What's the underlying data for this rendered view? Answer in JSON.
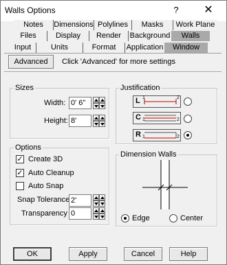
{
  "window": {
    "title": "Walls Options",
    "help_glyph": "?",
    "close_glyph": "✕"
  },
  "tabs": {
    "row1": [
      "Notes",
      "Dimensions",
      "Polylines",
      "Masks",
      "Work Plane"
    ],
    "row2": [
      "Files",
      "Display",
      "Render",
      "Background",
      "Walls"
    ],
    "row3": [
      "Input",
      "Units",
      "Format",
      "Application",
      "Window"
    ],
    "active": "Walls"
  },
  "advanced": {
    "button_label": "Advanced",
    "hint": "Click 'Advanced' for more settings"
  },
  "sizes": {
    "group_label": "Sizes",
    "width_label": "Width:",
    "width_value": "0' 6\"",
    "height_label": "Height:",
    "height_value": "8'"
  },
  "justification": {
    "group_label": "Justification",
    "options": [
      {
        "letter": "L",
        "sub_start": "1",
        "sub_end": "2",
        "selected": false
      },
      {
        "letter": "C",
        "sub_start": "1",
        "sub_end": "2",
        "selected": false
      },
      {
        "letter": "R",
        "sub_start": "1",
        "sub_end": "2",
        "selected": true
      }
    ]
  },
  "options": {
    "group_label": "Options",
    "create_3d": {
      "label": "Create 3D",
      "checked": true
    },
    "auto_cleanup": {
      "label": "Auto Cleanup",
      "checked": true
    },
    "auto_snap": {
      "label": "Auto Snap",
      "checked": false
    },
    "snap_tolerance_label": "Snap Tolerance",
    "snap_tolerance_value": "2'",
    "transparency_label": "Transparency",
    "transparency_value": "0"
  },
  "dimension_walls": {
    "group_label": "Dimension Walls",
    "edge_label": "Edge",
    "center_label": "Center",
    "selected": "Edge"
  },
  "footer": {
    "ok": "OK",
    "apply": "Apply",
    "cancel": "Cancel",
    "help": "Help"
  }
}
